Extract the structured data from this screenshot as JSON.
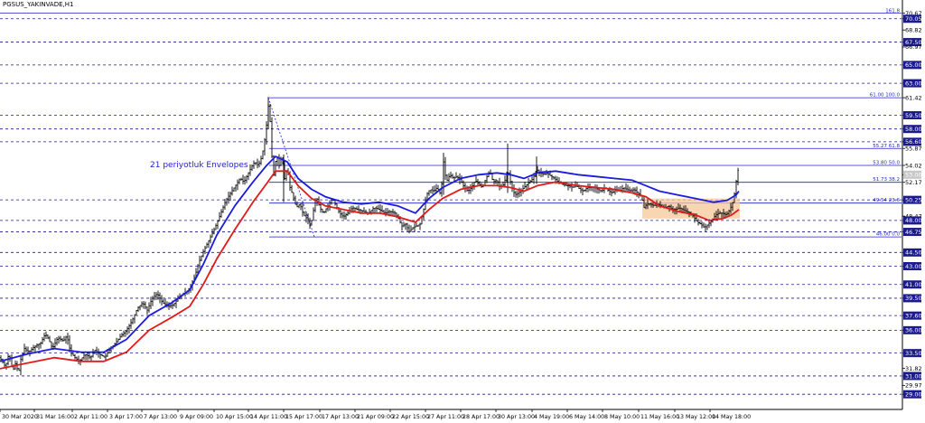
{
  "header": {
    "title": "PGSUS_YAKINVADE,H1"
  },
  "annotation": "21 periyotluk Envelopes",
  "colors": {
    "grid": "#1b1b8a",
    "fib": "#1f1fd0",
    "upper_band": "#1a1ae0",
    "lower_band": "#e01a1a",
    "candle": "#000000",
    "highlight_box": "#f5c89a",
    "current_price_box": "#c8c8c8",
    "axis_label_bg": "#1b1b8a"
  },
  "chart_data": {
    "type": "candlestick",
    "title": "PGSUS_YAKINVADE,H1",
    "ylim": [
      27.34,
      72.1
    ],
    "y_ticks": [
      "70.67",
      "68.82",
      "67.50",
      "65.00",
      "63.00",
      "61.42",
      "59.50",
      "58.00",
      "56.60",
      "55.87",
      "54.02",
      "52.17",
      "50.25",
      "48.47",
      "48.00",
      "46.75",
      "44.50",
      "43.00",
      "41.00",
      "39.50",
      "37.60",
      "36.00",
      "33.50",
      "31.82",
      "31.00",
      "29.97",
      "29.00"
    ],
    "price_axis_labels": [
      {
        "text": "70.67",
        "price": 70.67,
        "style": "text"
      },
      {
        "text": "70.05",
        "price": 70.05,
        "style": "box"
      },
      {
        "text": "68.82",
        "price": 68.82,
        "style": "text"
      },
      {
        "text": "67.50",
        "price": 67.5,
        "style": "box"
      },
      {
        "text": "66.97",
        "price": 66.97,
        "style": "text"
      },
      {
        "text": "65.00",
        "price": 65.0,
        "style": "box"
      },
      {
        "text": "63.00",
        "price": 63.0,
        "style": "box"
      },
      {
        "text": "61.42",
        "price": 61.42,
        "style": "text"
      },
      {
        "text": "59.50",
        "price": 59.5,
        "style": "box"
      },
      {
        "text": "58.00",
        "price": 58.0,
        "style": "box"
      },
      {
        "text": "56.60",
        "price": 56.6,
        "style": "box"
      },
      {
        "text": "55.87",
        "price": 55.87,
        "style": "text"
      },
      {
        "text": "54.02",
        "price": 54.02,
        "style": "text"
      },
      {
        "text": "53.00",
        "price": 53.0,
        "style": "current"
      },
      {
        "text": "52.17",
        "price": 52.17,
        "style": "text"
      },
      {
        "text": "50.25",
        "price": 50.25,
        "style": "box"
      },
      {
        "text": "48.47",
        "price": 48.47,
        "style": "text"
      },
      {
        "text": "48.00",
        "price": 48.0,
        "style": "box"
      },
      {
        "text": "46.75",
        "price": 46.75,
        "style": "box"
      },
      {
        "text": "44.50",
        "price": 44.5,
        "style": "box"
      },
      {
        "text": "43.00",
        "price": 43.0,
        "style": "box"
      },
      {
        "text": "41.00",
        "price": 41.0,
        "style": "box"
      },
      {
        "text": "39.50",
        "price": 39.5,
        "style": "box"
      },
      {
        "text": "37.60",
        "price": 37.6,
        "style": "box"
      },
      {
        "text": "36.00",
        "price": 36.0,
        "style": "box"
      },
      {
        "text": "33.50",
        "price": 33.5,
        "style": "box"
      },
      {
        "text": "31.82",
        "price": 31.82,
        "style": "text"
      },
      {
        "text": "31.00",
        "price": 31.0,
        "style": "box"
      },
      {
        "text": "29.97",
        "price": 29.97,
        "style": "text"
      },
      {
        "text": "29.00",
        "price": 29.0,
        "style": "box"
      }
    ],
    "horizontal_levels": [
      70.05,
      67.5,
      65.0,
      63.0,
      59.5,
      58.0,
      56.6,
      50.25,
      48.0,
      46.75,
      44.5,
      43.0,
      41.0,
      39.5,
      37.6,
      36.0,
      33.5,
      31.0,
      29.0
    ],
    "top_level": {
      "price": 70.67,
      "label": "161.8"
    },
    "fibonacci": [
      {
        "label": "61.00 100.0",
        "price": 61.42
      },
      {
        "label": "55.27 61.8",
        "price": 55.87
      },
      {
        "label": "53.80 50.0",
        "price": 54.02
      },
      {
        "label": "51.73 38.2",
        "price": 52.17
      },
      {
        "label": "49.54 23.6",
        "price": 49.9
      },
      {
        "label": "46.00 0.0",
        "price": 46.2
      }
    ],
    "x_labels": [
      "30 Mar 2020",
      "31 Mar 16:00",
      "2 Apr 11:00",
      "3 Apr 17:00",
      "7 Apr 13:00",
      "9 Apr 09:00",
      "10 Apr 15:00",
      "14 Apr 11:00",
      "15 Apr 17:00",
      "17 Apr 13:00",
      "21 Apr 09:00",
      "22 Apr 15:00",
      "27 Apr 11:00",
      "28 Apr 17:00",
      "30 Apr 13:00",
      "4 May 19:00",
      "6 May 14:00",
      "8 May 10:00",
      "11 May 16:00",
      "13 May 12:00",
      "14 May 18:00"
    ],
    "price_path": [
      [
        0,
        33.0
      ],
      [
        6,
        32.0
      ],
      [
        10,
        33.5
      ],
      [
        14,
        31.5
      ],
      [
        18,
        32.6
      ],
      [
        20,
        31.0
      ],
      [
        23,
        32.8
      ],
      [
        27,
        34.0
      ],
      [
        32,
        33.6
      ],
      [
        38,
        34.2
      ],
      [
        45,
        34.6
      ],
      [
        50,
        35.6
      ],
      [
        54,
        35.0
      ],
      [
        58,
        34.0
      ],
      [
        64,
        35.2
      ],
      [
        70,
        34.8
      ],
      [
        74,
        35.4
      ],
      [
        78,
        33.6
      ],
      [
        83,
        33.0
      ],
      [
        88,
        32.6
      ],
      [
        94,
        33.4
      ],
      [
        100,
        33.0
      ],
      [
        105,
        33.8
      ],
      [
        110,
        33.4
      ],
      [
        116,
        33.0
      ],
      [
        122,
        34.0
      ],
      [
        128,
        34.6
      ],
      [
        134,
        35.4
      ],
      [
        140,
        36.0
      ],
      [
        146,
        37.0
      ],
      [
        152,
        38.4
      ],
      [
        158,
        39.0
      ],
      [
        163,
        38.2
      ],
      [
        168,
        39.4
      ],
      [
        174,
        40.0
      ],
      [
        180,
        39.0
      ],
      [
        186,
        38.6
      ],
      [
        192,
        38.8
      ],
      [
        198,
        39.6
      ],
      [
        204,
        40.0
      ],
      [
        210,
        40.6
      ],
      [
        216,
        42.0
      ],
      [
        220,
        43.4
      ],
      [
        225,
        44.6
      ],
      [
        230,
        45.6
      ],
      [
        234,
        46.4
      ],
      [
        238,
        47.2
      ],
      [
        242,
        48.2
      ],
      [
        246,
        49.2
      ],
      [
        250,
        50.2
      ],
      [
        254,
        50.8
      ],
      [
        258,
        51.4
      ],
      [
        262,
        52.0
      ],
      [
        266,
        52.6
      ],
      [
        270,
        52.2
      ],
      [
        274,
        53.0
      ],
      [
        278,
        53.8
      ],
      [
        282,
        54.4
      ],
      [
        286,
        54.0
      ],
      [
        290,
        55.0
      ],
      [
        294,
        57.4
      ],
      [
        297,
        60.5
      ],
      [
        299,
        58.8
      ],
      [
        301,
        55.0
      ],
      [
        303,
        53.0
      ],
      [
        306,
        55.2
      ],
      [
        309,
        54.0
      ],
      [
        312,
        55.0
      ],
      [
        315,
        52.6
      ],
      [
        318,
        53.8
      ],
      [
        321,
        51.6
      ],
      [
        324,
        50.8
      ],
      [
        328,
        49.4
      ],
      [
        332,
        49.8
      ],
      [
        336,
        48.6
      ],
      [
        340,
        48.2
      ],
      [
        344,
        47.4
      ],
      [
        346,
        48.6
      ],
      [
        350,
        50.6
      ],
      [
        354,
        49.4
      ],
      [
        358,
        48.8
      ],
      [
        363,
        49.6
      ],
      [
        368,
        50.4
      ],
      [
        372,
        49.6
      ],
      [
        376,
        48.8
      ],
      [
        380,
        48.4
      ],
      [
        385,
        48.8
      ],
      [
        390,
        49.4
      ],
      [
        396,
        49.2
      ],
      [
        402,
        49.0
      ],
      [
        408,
        48.8
      ],
      [
        414,
        49.4
      ],
      [
        420,
        49.2
      ],
      [
        426,
        48.8
      ],
      [
        432,
        49.0
      ],
      [
        437,
        48.8
      ],
      [
        441,
        48.2
      ],
      [
        445,
        47.4
      ],
      [
        449,
        47.6
      ],
      [
        453,
        46.8
      ],
      [
        457,
        47.2
      ],
      [
        461,
        47.4
      ],
      [
        465,
        47.6
      ],
      [
        469,
        49.2
      ],
      [
        472,
        50.8
      ],
      [
        476,
        51.4
      ],
      [
        480,
        51.2
      ],
      [
        484,
        51.6
      ],
      [
        488,
        50.8
      ],
      [
        491,
        54.4
      ],
      [
        494,
        52.2
      ],
      [
        498,
        53.0
      ],
      [
        502,
        52.6
      ],
      [
        506,
        52.8
      ],
      [
        510,
        52.4
      ],
      [
        514,
        51.6
      ],
      [
        518,
        51.2
      ],
      [
        522,
        51.6
      ],
      [
        526,
        52.4
      ],
      [
        530,
        52.0
      ],
      [
        534,
        51.6
      ],
      [
        538,
        52.6
      ],
      [
        542,
        53.4
      ],
      [
        546,
        52.2
      ],
      [
        550,
        52.4
      ],
      [
        554,
        51.6
      ],
      [
        558,
        52.0
      ],
      [
        562,
        53.6
      ],
      [
        566,
        51.8
      ],
      [
        570,
        50.8
      ],
      [
        574,
        51.0
      ],
      [
        578,
        51.4
      ],
      [
        582,
        51.8
      ],
      [
        586,
        52.2
      ],
      [
        590,
        52.6
      ],
      [
        594,
        53.6
      ],
      [
        598,
        53.2
      ],
      [
        602,
        53.0
      ],
      [
        606,
        53.2
      ],
      [
        610,
        52.8
      ],
      [
        614,
        52.6
      ],
      [
        618,
        52.2
      ],
      [
        622,
        52.0
      ],
      [
        626,
        51.8
      ],
      [
        630,
        51.8
      ],
      [
        634,
        51.6
      ],
      [
        638,
        51.8
      ],
      [
        642,
        51.4
      ],
      [
        646,
        51.2
      ],
      [
        650,
        51.6
      ],
      [
        654,
        51.6
      ],
      [
        658,
        51.6
      ],
      [
        662,
        51.4
      ],
      [
        666,
        51.2
      ],
      [
        670,
        51.6
      ],
      [
        674,
        51.2
      ],
      [
        678,
        51.0
      ],
      [
        682,
        51.4
      ],
      [
        686,
        51.2
      ],
      [
        690,
        51.6
      ],
      [
        694,
        51.4
      ],
      [
        698,
        51.2
      ],
      [
        702,
        51.4
      ],
      [
        706,
        51.0
      ],
      [
        710,
        50.6
      ],
      [
        713,
        49.4
      ],
      [
        716,
        49.8
      ],
      [
        720,
        49.8
      ],
      [
        724,
        49.6
      ],
      [
        728,
        49.8
      ],
      [
        732,
        49.6
      ],
      [
        736,
        49.4
      ],
      [
        740,
        49.6
      ],
      [
        744,
        49.2
      ],
      [
        748,
        49.2
      ],
      [
        752,
        49.4
      ],
      [
        756,
        49.2
      ],
      [
        760,
        49.0
      ],
      [
        764,
        48.8
      ],
      [
        768,
        48.4
      ],
      [
        772,
        47.8
      ],
      [
        776,
        47.6
      ],
      [
        780,
        47.2
      ],
      [
        784,
        47.6
      ],
      [
        788,
        48.0
      ],
      [
        792,
        48.6
      ],
      [
        796,
        48.8
      ],
      [
        800,
        48.8
      ],
      [
        804,
        48.6
      ],
      [
        808,
        49.2
      ],
      [
        812,
        50.2
      ],
      [
        816,
        53.0
      ],
      [
        818,
        54.0
      ]
    ],
    "upper_envelope": [
      [
        0,
        32.6
      ],
      [
        30,
        33.4
      ],
      [
        60,
        34.0
      ],
      [
        90,
        33.6
      ],
      [
        115,
        33.6
      ],
      [
        140,
        35.0
      ],
      [
        165,
        37.6
      ],
      [
        190,
        39.0
      ],
      [
        210,
        40.4
      ],
      [
        225,
        43.2
      ],
      [
        240,
        46.4
      ],
      [
        260,
        49.6
      ],
      [
        280,
        52.2
      ],
      [
        295,
        54.0
      ],
      [
        305,
        55.0
      ],
      [
        318,
        54.4
      ],
      [
        330,
        52.6
      ],
      [
        345,
        51.4
      ],
      [
        360,
        50.6
      ],
      [
        380,
        50.0
      ],
      [
        400,
        49.8
      ],
      [
        420,
        50.0
      ],
      [
        440,
        49.6
      ],
      [
        460,
        48.8
      ],
      [
        475,
        50.4
      ],
      [
        490,
        51.6
      ],
      [
        510,
        52.6
      ],
      [
        530,
        53.0
      ],
      [
        550,
        53.2
      ],
      [
        565,
        53.0
      ],
      [
        580,
        52.6
      ],
      [
        595,
        53.2
      ],
      [
        615,
        53.4
      ],
      [
        640,
        53.0
      ],
      [
        660,
        52.8
      ],
      [
        680,
        52.6
      ],
      [
        700,
        52.4
      ],
      [
        715,
        51.8
      ],
      [
        730,
        51.2
      ],
      [
        750,
        50.8
      ],
      [
        770,
        50.4
      ],
      [
        790,
        50.0
      ],
      [
        805,
        50.2
      ],
      [
        815,
        50.8
      ],
      [
        818,
        51.2
      ]
    ],
    "lower_envelope": [
      [
        0,
        31.8
      ],
      [
        30,
        32.4
      ],
      [
        60,
        33.0
      ],
      [
        90,
        32.6
      ],
      [
        115,
        32.6
      ],
      [
        140,
        33.6
      ],
      [
        165,
        36.0
      ],
      [
        190,
        37.4
      ],
      [
        210,
        38.6
      ],
      [
        225,
        41.0
      ],
      [
        240,
        43.8
      ],
      [
        260,
        47.0
      ],
      [
        280,
        50.0
      ],
      [
        295,
        52.0
      ],
      [
        305,
        53.4
      ],
      [
        318,
        53.4
      ],
      [
        330,
        51.8
      ],
      [
        345,
        50.4
      ],
      [
        360,
        49.6
      ],
      [
        380,
        49.2
      ],
      [
        400,
        48.8
      ],
      [
        420,
        48.8
      ],
      [
        440,
        48.4
      ],
      [
        460,
        47.8
      ],
      [
        475,
        49.2
      ],
      [
        490,
        50.4
      ],
      [
        510,
        51.4
      ],
      [
        530,
        51.8
      ],
      [
        550,
        51.8
      ],
      [
        565,
        51.6
      ],
      [
        580,
        51.2
      ],
      [
        595,
        51.8
      ],
      [
        615,
        52.2
      ],
      [
        640,
        51.8
      ],
      [
        660,
        51.6
      ],
      [
        680,
        51.4
      ],
      [
        700,
        51.0
      ],
      [
        715,
        50.6
      ],
      [
        730,
        49.6
      ],
      [
        750,
        49.0
      ],
      [
        770,
        48.6
      ],
      [
        785,
        48.0
      ],
      [
        800,
        48.2
      ],
      [
        810,
        48.6
      ],
      [
        818,
        49.2
      ]
    ],
    "highlight_zone": {
      "from_x_label": "11 May 16:00",
      "price_from": 48.2,
      "price_to": 50.4
    },
    "current_price": 53.0,
    "grid": "dashed horizontal levels"
  }
}
